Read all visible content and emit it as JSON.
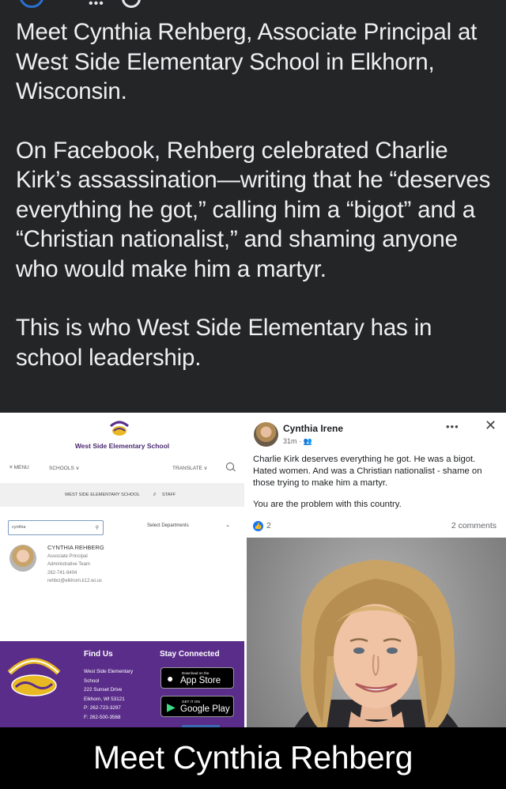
{
  "post": {
    "paragraphs": [
      "Meet Cynthia Rehberg, Associate Principal at West Side Elementary School in Elkhorn, Wisconsin.",
      "On Facebook, Rehberg celebrated Charlie Kirk’s assassination—writing that he “deserves everything he got,” calling him a “bigot” and a “Christian nationalist,” and shaming anyone who would make him a martyr.",
      "This is who West Side Elementary has in school leadership."
    ]
  },
  "school_site": {
    "name": "West Side Elementary School",
    "nav": {
      "menu": "≡ MENU",
      "schools": "SCHOOLS ∨",
      "translate": "TRANSLATE ∨"
    },
    "breadcrumb": {
      "school": "WEST SIDE ELEMENTARY SCHOOL",
      "sep": "//",
      "page": "STAFF"
    },
    "search_value": "cynthia",
    "dept_select": "Select Departments",
    "staff": {
      "name": "CYNTHIA REHBERG",
      "title": "Associate Principal",
      "team": "Administrative Team",
      "phone": "262-741-9404",
      "email": "rehbci@elkhorn.k12.wi.us"
    },
    "footer": {
      "find_us": "Find Us",
      "address_lines": [
        "West Side Elementary",
        "School",
        "222 Sunset Drive",
        "Elkhorn, WI 53121",
        "P: 262-723-3297",
        "F: 262-500-3568"
      ],
      "stay_connected": "Stay Connected",
      "app_store_small": "Download on the",
      "app_store_big": "App Store",
      "google_small": "GET IT ON",
      "google_big": "Google Play"
    }
  },
  "fb_post": {
    "author": "Cynthia Irene",
    "time": "31m · ",
    "paragraph1": "Charlie Kirk deserves everything he got. He was a bigot. Hated women. And was a Christian nationalist - shame on those trying to make him a martyr.",
    "paragraph2": "You are the problem with this country.",
    "reactions": "2",
    "comments": "2 comments"
  },
  "caption": "Meet Cynthia Rehberg",
  "colors": {
    "background": "#232527",
    "school_purple": "#5a2d8a",
    "fb_blue": "#1877f2"
  }
}
